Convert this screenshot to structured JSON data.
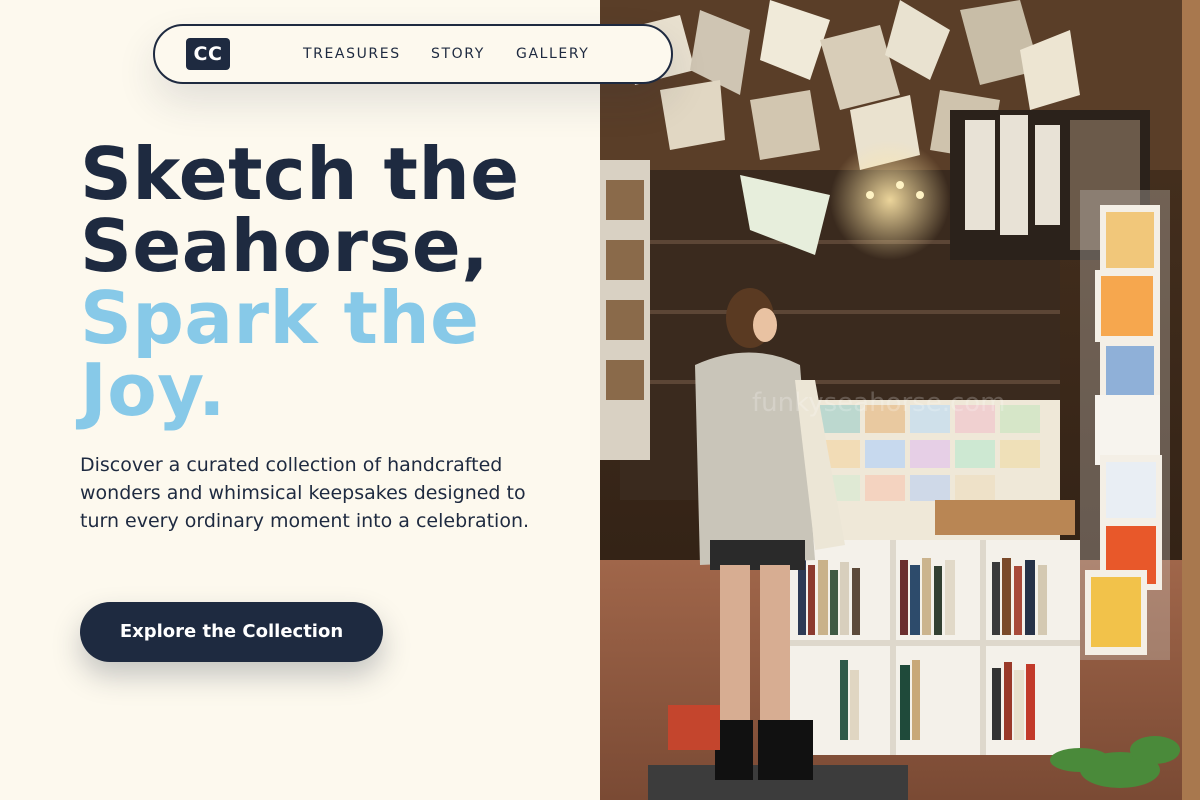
{
  "brand": {
    "logo_text": "CC"
  },
  "nav": {
    "links": [
      "TREASURES",
      "STORY",
      "GALLERY"
    ]
  },
  "hero": {
    "headline_line1": "Sketch the",
    "headline_line2": "Seahorse,",
    "headline_line3": "Spark the",
    "headline_line4": "Joy.",
    "description": "Discover a curated collection of handcrafted wonders and whimsical keepsakes designed to turn every ordinary moment into a celebration.",
    "cta_label": "Explore the Collection"
  },
  "image": {
    "alt": "Person browsing postcards and books inside a cozy shop with books hanging from the ceiling",
    "watermark": "funkyseahorse.com"
  },
  "colors": {
    "background": "#fdf9ee",
    "navy": "#1e2a40",
    "accent_blue": "#87c9e8"
  }
}
